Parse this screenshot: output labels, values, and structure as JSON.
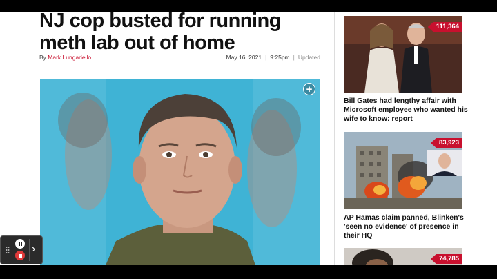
{
  "article": {
    "headline": "NJ cop busted for running meth lab out of home",
    "byline_prefix": "By",
    "author": "Mark Lungariello",
    "date": "May 16, 2021",
    "time": "9:25pm",
    "updated_label": "Updated",
    "expand_glyph": "+"
  },
  "sidebar": {
    "cards": [
      {
        "count": "111,364",
        "title": "Bill Gates had lengthy affair with Microsoft employee who wanted his wife to know: report"
      },
      {
        "count": "83,923",
        "title": "AP Hamas claim panned, Blinken's 'seen no evidence' of presence in their HQ"
      },
      {
        "count": "74,785",
        "title": ""
      }
    ]
  },
  "recorder": {
    "next_glyph": "›"
  },
  "colors": {
    "brand_red": "#c8102e",
    "photo_bg": "#3fb3d5"
  }
}
